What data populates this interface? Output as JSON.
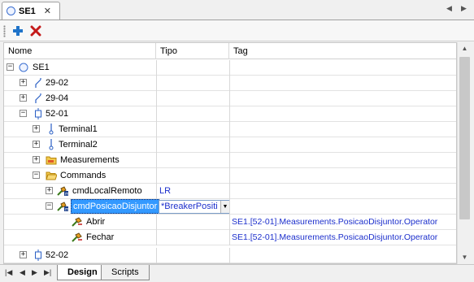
{
  "document_tab": {
    "title": "SE1",
    "close": "✕"
  },
  "strip_nav": {
    "left": "◀",
    "right": "▶"
  },
  "toolbar": {
    "add_label": "✚",
    "delete_label": "✕"
  },
  "grid": {
    "columns": [
      "Nome",
      "Tipo",
      "Tag"
    ],
    "rows": [
      {
        "name": "SE1",
        "tipo": "",
        "tag": "",
        "expander": "⊟",
        "icon": "circle-icon"
      },
      {
        "name": "29-02",
        "tipo": "",
        "tag": "",
        "expander": "+",
        "icon": "switch-icon"
      },
      {
        "name": "29-04",
        "tipo": "",
        "tag": "",
        "expander": "+",
        "icon": "switch-icon"
      },
      {
        "name": "52-01",
        "tipo": "",
        "tag": "",
        "expander": "−",
        "icon": "breaker-icon"
      },
      {
        "name": "Terminal1",
        "tipo": "",
        "tag": "",
        "expander": "+",
        "icon": "terminal-icon"
      },
      {
        "name": "Terminal2",
        "tipo": "",
        "tag": "",
        "expander": "+",
        "icon": "terminal-icon"
      },
      {
        "name": "Measurements",
        "tipo": "",
        "tag": "",
        "expander": "+",
        "icon": "folder-icon"
      },
      {
        "name": "Commands",
        "tipo": "",
        "tag": "",
        "expander": "−",
        "icon": "folder-open-icon"
      },
      {
        "name": "cmdLocalRemoto",
        "tipo": "LR",
        "tag": "",
        "expander": "+",
        "icon": "command-icon"
      },
      {
        "name": "cmdPosicaoDisjuntor",
        "tipo": "*BreakerPositio",
        "tag": "",
        "expander": "−",
        "icon": "command-icon"
      },
      {
        "name": "Abrir",
        "tipo": "",
        "tag": "SE1.[52-01].Measurements.PosicaoDisjuntor.Operator",
        "expander": "",
        "icon": "command-item-icon"
      },
      {
        "name": "Fechar",
        "tipo": "",
        "tag": "SE1.[52-01].Measurements.PosicaoDisjuntor.Operator",
        "expander": "",
        "icon": "command-item-icon"
      },
      {
        "name": "52-02",
        "tipo": "",
        "tag": "",
        "expander": "+",
        "icon": "breaker-icon"
      }
    ]
  },
  "bottom_tabs": [
    "Design",
    "Scripts"
  ],
  "bottom_nav": [
    "|◀",
    "◀",
    "▶",
    "▶|"
  ],
  "colors": {
    "selection": "#3399ff",
    "link_text": "#1c2fcc"
  }
}
